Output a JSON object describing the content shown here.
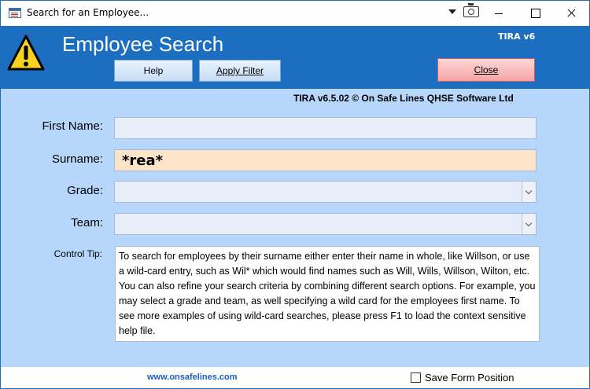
{
  "window": {
    "title": "Search for an Employee..."
  },
  "header": {
    "title": "Employee Search",
    "version": "TIRA v6",
    "help_label": "Help",
    "apply_filter_label": "Apply Filter",
    "close_label": "Close"
  },
  "copyright": "TIRA v6.5.02 © On Safe Lines QHSE Software Ltd",
  "form": {
    "first_name_label": "First Name:",
    "first_name_value": "",
    "surname_label": "Surname:",
    "surname_value": "*rea*",
    "grade_label": "Grade:",
    "grade_value": "",
    "team_label": "Team:",
    "team_value": "",
    "control_tip_label": "Control Tip:",
    "control_tip_text": "To search for employees by their surname either enter their name in whole, like Willson, or use a wild-card entry, such as Wil* which would find names such as Will, Wills, Willson, Wilton, etc.  You can also refine your search criteria by combining different search options.  For example, you may select a grade and team, as well specifying a wild card for the employees first name.  To see more examples of using wild-card searches, please press F1 to load the context sensitive help file."
  },
  "footer": {
    "link": "www.onsafelines.com",
    "save_position_label": "Save Form Position",
    "save_position_checked": false
  },
  "colors": {
    "header_bg": "#1c6ec0",
    "form_bg": "#b7d6fb",
    "surname_bg": "#fde3c8",
    "close_btn": "#f5a5a5"
  },
  "icons": {
    "app": "form-icon",
    "warning": "warning-icon",
    "dropdown": "chevron-down-icon",
    "camera": "camera-icon"
  }
}
